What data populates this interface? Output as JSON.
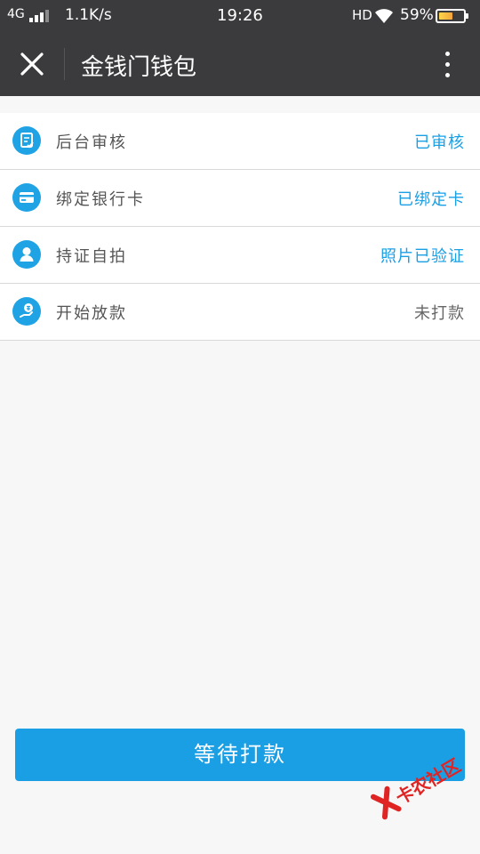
{
  "status_bar": {
    "network": "4G",
    "speed": "1.1K/s",
    "time": "19:26",
    "hd": "HD",
    "battery_pct": "59%",
    "battery_level": 0.59
  },
  "app_bar": {
    "title": "金钱门钱包",
    "close_icon": "close-icon",
    "more_icon": "more-vertical-icon"
  },
  "steps": [
    {
      "label": "后台审核",
      "status": "已审核",
      "status_color": "#1a9fe5",
      "icon": "review-icon"
    },
    {
      "label": "绑定银行卡",
      "status": "已绑定卡",
      "status_color": "#1a9fe5",
      "icon": "card-icon"
    },
    {
      "label": "持证自拍",
      "status": "照片已验证",
      "status_color": "#1a9fe5",
      "icon": "user-icon"
    },
    {
      "label": "开始放款",
      "status": "未打款",
      "status_color": "#666666",
      "icon": "money-hand-icon"
    }
  ],
  "action_button": {
    "label": "等待打款"
  },
  "watermark": {
    "text": "卡农社区"
  },
  "colors": {
    "accent": "#1a9fe5",
    "bar": "#3b3b3d",
    "background": "#f7f7f7"
  }
}
